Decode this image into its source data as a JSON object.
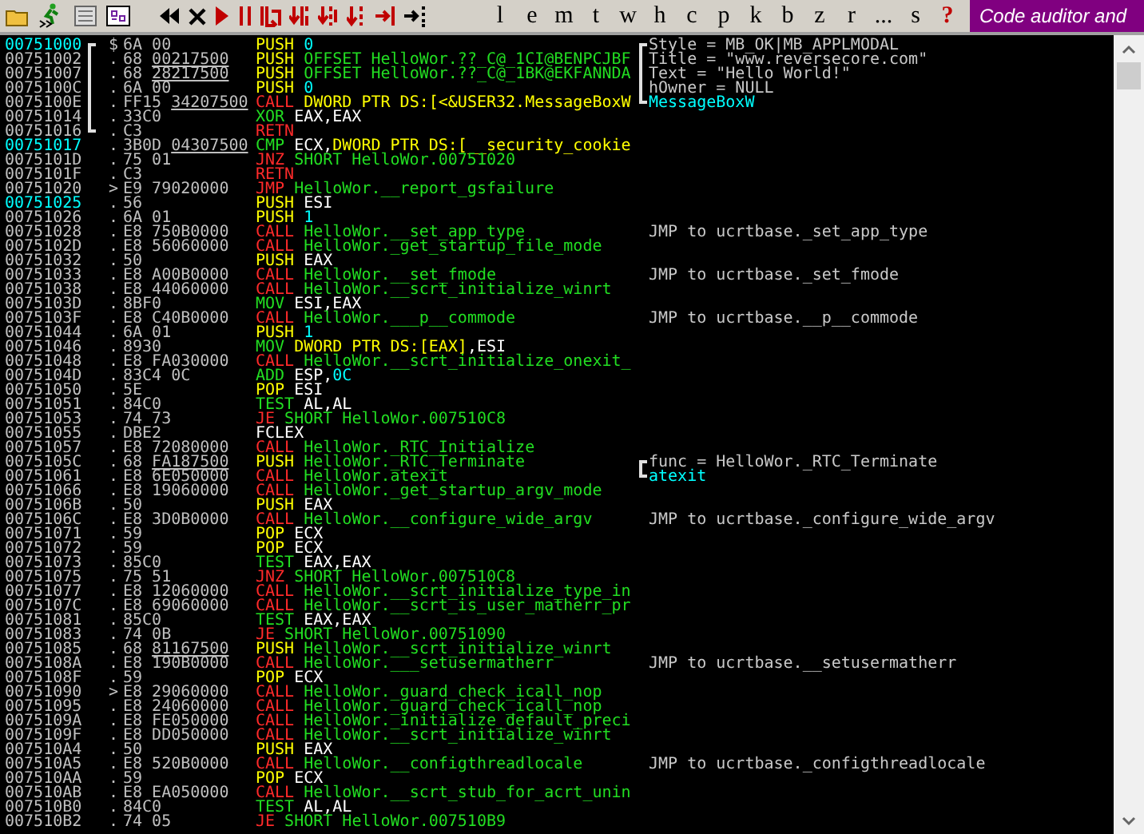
{
  "toolbar": {
    "letters": [
      "l",
      "e",
      "m",
      "t",
      "w",
      "h",
      "c",
      "p",
      "k",
      "b",
      "z",
      "r",
      "...",
      "s"
    ],
    "help": "?",
    "banner": "Code auditor and"
  },
  "rows": [
    {
      "address": "00751000",
      "entry": true,
      "mark": "$",
      "bracket": {
        "kind": "top"
      },
      "hex": "6A 00",
      "mnemonic": "PUSH",
      "kind": "push",
      "operand": [
        {
          "text": "0",
          "kind": "const"
        }
      ],
      "comment": {
        "text": "Style = MB_OK|MB_APPLMODAL",
        "kind": "arg",
        "bracket": {
          "kind": "top"
        }
      }
    },
    {
      "address": "00751002",
      "entry": false,
      "mark": ".",
      "bracket": {
        "kind": "mid"
      },
      "hex": "68",
      "ref": "00217500",
      "mnemonic": "PUSH",
      "kind": "push",
      "operand": [
        {
          "text": "OFFSET HelloWor.??_C@_1CI@BENPCJBF",
          "kind": "label"
        }
      ],
      "comment": {
        "text": "Title = \"www.reversecore.com\"",
        "kind": "arg",
        "bracket": {
          "kind": "mid"
        }
      }
    },
    {
      "address": "00751007",
      "entry": false,
      "mark": ".",
      "bracket": {
        "kind": "mid"
      },
      "hex": "68",
      "ref": "28217500",
      "mnemonic": "PUSH",
      "kind": "push",
      "operand": [
        {
          "text": "OFFSET HelloWor.??_C@_1BK@EKFANNDA",
          "kind": "label"
        }
      ],
      "comment": {
        "text": "Text = \"Hello World!\"",
        "kind": "arg",
        "bracket": {
          "kind": "mid"
        }
      }
    },
    {
      "address": "0075100C",
      "entry": false,
      "mark": ".",
      "bracket": {
        "kind": "mid"
      },
      "hex": "6A 00",
      "mnemonic": "PUSH",
      "kind": "push",
      "operand": [
        {
          "text": "0",
          "kind": "const"
        }
      ],
      "comment": {
        "text": "hOwner = NULL",
        "kind": "arg",
        "bracket": {
          "kind": "mid"
        }
      }
    },
    {
      "address": "0075100E",
      "entry": false,
      "mark": ".",
      "bracket": {
        "kind": "mid"
      },
      "hex": "FF15",
      "ref": "34207500",
      "mnemonic": "CALL",
      "kind": "call",
      "operand": [
        {
          "text": "DWORD PTR DS:[<&USER32.MessageBoxW",
          "kind": "mem"
        }
      ],
      "comment": {
        "text": "MessageBoxW",
        "kind": "api",
        "bracket": {
          "kind": "end"
        }
      }
    },
    {
      "address": "00751014",
      "entry": false,
      "mark": ".",
      "bracket": {
        "kind": "mid"
      },
      "hex": "33C0",
      "mnemonic": "XOR",
      "kind": "alu",
      "operand": [
        {
          "text": "EAX,EAX",
          "kind": "reg"
        }
      ]
    },
    {
      "address": "00751016",
      "entry": false,
      "mark": ".",
      "bracket": {
        "kind": "end"
      },
      "hex": "C3",
      "mnemonic": "RETN",
      "kind": "jump"
    },
    {
      "address": "00751017",
      "entry": true,
      "mark": ".",
      "hex": "3B0D",
      "ref": "04307500",
      "mnemonic": "CMP",
      "kind": "alu",
      "operand": [
        {
          "text": "ECX,",
          "kind": "reg"
        },
        {
          "text": "DWORD PTR DS:[__security_cookie",
          "kind": "mem"
        }
      ]
    },
    {
      "address": "0075101D",
      "entry": false,
      "mark": ".",
      "hex": "75 01",
      "mnemonic": "JNZ",
      "kind": "jump",
      "operand": [
        {
          "text": "SHORT HelloWor.00751020",
          "kind": "label"
        }
      ]
    },
    {
      "address": "0075101F",
      "entry": false,
      "mark": ".",
      "hex": "C3",
      "mnemonic": "RETN",
      "kind": "jump"
    },
    {
      "address": "00751020",
      "entry": false,
      "mark": ">",
      "hex": "E9 79020000",
      "mnemonic": "JMP",
      "kind": "jump",
      "operand": [
        {
          "text": "HelloWor.__report_gsfailure",
          "kind": "label"
        }
      ]
    },
    {
      "address": "00751025",
      "entry": true,
      "mark": ".",
      "hex": "56",
      "mnemonic": "PUSH",
      "kind": "push",
      "operand": [
        {
          "text": "ESI",
          "kind": "reg"
        }
      ]
    },
    {
      "address": "00751026",
      "entry": false,
      "mark": ".",
      "hex": "6A 01",
      "mnemonic": "PUSH",
      "kind": "push",
      "operand": [
        {
          "text": "1",
          "kind": "const"
        }
      ]
    },
    {
      "address": "00751028",
      "entry": false,
      "mark": ".",
      "hex": "E8 750B0000",
      "mnemonic": "CALL",
      "kind": "call",
      "operand": [
        {
          "text": "HelloWor.__set_app_type",
          "kind": "label"
        }
      ],
      "comment": {
        "text": "JMP to ucrtbase._set_app_type",
        "kind": "note"
      }
    },
    {
      "address": "0075102D",
      "entry": false,
      "mark": ".",
      "hex": "E8 56060000",
      "mnemonic": "CALL",
      "kind": "call",
      "operand": [
        {
          "text": "HelloWor._get_startup_file_mode",
          "kind": "label"
        }
      ]
    },
    {
      "address": "00751032",
      "entry": false,
      "mark": ".",
      "hex": "50",
      "mnemonic": "PUSH",
      "kind": "push",
      "operand": [
        {
          "text": "EAX",
          "kind": "reg"
        }
      ]
    },
    {
      "address": "00751033",
      "entry": false,
      "mark": ".",
      "hex": "E8 A00B0000",
      "mnemonic": "CALL",
      "kind": "call",
      "operand": [
        {
          "text": "HelloWor.__set_fmode",
          "kind": "label"
        }
      ],
      "comment": {
        "text": "JMP to ucrtbase._set_fmode",
        "kind": "note"
      }
    },
    {
      "address": "00751038",
      "entry": false,
      "mark": ".",
      "hex": "E8 44060000",
      "mnemonic": "CALL",
      "kind": "call",
      "operand": [
        {
          "text": "HelloWor.__scrt_initialize_winrt",
          "kind": "label"
        }
      ]
    },
    {
      "address": "0075103D",
      "entry": false,
      "mark": ".",
      "hex": "8BF0",
      "mnemonic": "MOV",
      "kind": "alu",
      "operand": [
        {
          "text": "ESI,EAX",
          "kind": "reg"
        }
      ]
    },
    {
      "address": "0075103F",
      "entry": false,
      "mark": ".",
      "hex": "E8 C40B0000",
      "mnemonic": "CALL",
      "kind": "call",
      "operand": [
        {
          "text": "HelloWor.___p__commode",
          "kind": "label"
        }
      ],
      "comment": {
        "text": "JMP to ucrtbase.__p__commode",
        "kind": "note"
      }
    },
    {
      "address": "00751044",
      "entry": false,
      "mark": ".",
      "hex": "6A 01",
      "mnemonic": "PUSH",
      "kind": "push",
      "operand": [
        {
          "text": "1",
          "kind": "const"
        }
      ]
    },
    {
      "address": "00751046",
      "entry": false,
      "mark": ".",
      "hex": "8930",
      "mnemonic": "MOV",
      "kind": "alu",
      "operand": [
        {
          "text": "DWORD PTR DS:[EAX]",
          "kind": "mem"
        },
        {
          "text": ",ESI",
          "kind": "reg"
        }
      ]
    },
    {
      "address": "00751048",
      "entry": false,
      "mark": ".",
      "hex": "E8 FA030000",
      "mnemonic": "CALL",
      "kind": "call",
      "operand": [
        {
          "text": "HelloWor.__scrt_initialize_onexit_",
          "kind": "label"
        }
      ]
    },
    {
      "address": "0075104D",
      "entry": false,
      "mark": ".",
      "hex": "83C4 0C",
      "mnemonic": "ADD",
      "kind": "alu",
      "operand": [
        {
          "text": "ESP,",
          "kind": "reg"
        },
        {
          "text": "0C",
          "kind": "const"
        }
      ]
    },
    {
      "address": "00751050",
      "entry": false,
      "mark": ".",
      "hex": "5E",
      "mnemonic": "POP",
      "kind": "push",
      "operand": [
        {
          "text": "ESI",
          "kind": "reg"
        }
      ]
    },
    {
      "address": "00751051",
      "entry": false,
      "mark": ".",
      "hex": "84C0",
      "mnemonic": "TEST",
      "kind": "alu",
      "operand": [
        {
          "text": "AL,AL",
          "kind": "reg"
        }
      ]
    },
    {
      "address": "00751053",
      "entry": false,
      "mark": ".",
      "hex": "74 73",
      "mnemonic": "JE",
      "kind": "jump",
      "operand": [
        {
          "text": "SHORT HelloWor.007510C8",
          "kind": "label"
        }
      ]
    },
    {
      "address": "00751055",
      "entry": false,
      "mark": ".",
      "hex": "DBE2",
      "mnemonic": "FCLEX",
      "kind": "fpu"
    },
    {
      "address": "00751057",
      "entry": false,
      "mark": ".",
      "hex": "E8 72080000",
      "mnemonic": "CALL",
      "kind": "call",
      "operand": [
        {
          "text": "HelloWor._RTC_Initialize",
          "kind": "label"
        }
      ]
    },
    {
      "address": "0075105C",
      "entry": false,
      "mark": ".",
      "hex": "68",
      "ref": "FA187500",
      "mnemonic": "PUSH",
      "kind": "push",
      "operand": [
        {
          "text": "HelloWor._RTC_Terminate",
          "kind": "label"
        }
      ],
      "comment": {
        "text": "func = HelloWor._RTC_Terminate",
        "kind": "arg",
        "bracket": {
          "kind": "top"
        }
      }
    },
    {
      "address": "00751061",
      "entry": false,
      "mark": ".",
      "hex": "E8 6E050000",
      "mnemonic": "CALL",
      "kind": "call",
      "operand": [
        {
          "text": "HelloWor.atexit",
          "kind": "label"
        }
      ],
      "comment": {
        "text": "atexit",
        "kind": "api",
        "bracket": {
          "kind": "end"
        }
      }
    },
    {
      "address": "00751066",
      "entry": false,
      "mark": ".",
      "hex": "E8 19060000",
      "mnemonic": "CALL",
      "kind": "call",
      "operand": [
        {
          "text": "HelloWor._get_startup_argv_mode",
          "kind": "label"
        }
      ]
    },
    {
      "address": "0075106B",
      "entry": false,
      "mark": ".",
      "hex": "50",
      "mnemonic": "PUSH",
      "kind": "push",
      "operand": [
        {
          "text": "EAX",
          "kind": "reg"
        }
      ]
    },
    {
      "address": "0075106C",
      "entry": false,
      "mark": ".",
      "hex": "E8 3D0B0000",
      "mnemonic": "CALL",
      "kind": "call",
      "operand": [
        {
          "text": "HelloWor.__configure_wide_argv",
          "kind": "label"
        }
      ],
      "comment": {
        "text": "JMP to ucrtbase._configure_wide_argv",
        "kind": "note"
      }
    },
    {
      "address": "00751071",
      "entry": false,
      "mark": ".",
      "hex": "59",
      "mnemonic": "POP",
      "kind": "push",
      "operand": [
        {
          "text": "ECX",
          "kind": "reg"
        }
      ]
    },
    {
      "address": "00751072",
      "entry": false,
      "mark": ".",
      "hex": "59",
      "mnemonic": "POP",
      "kind": "push",
      "operand": [
        {
          "text": "ECX",
          "kind": "reg"
        }
      ]
    },
    {
      "address": "00751073",
      "entry": false,
      "mark": ".",
      "hex": "85C0",
      "mnemonic": "TEST",
      "kind": "alu",
      "operand": [
        {
          "text": "EAX,EAX",
          "kind": "reg"
        }
      ]
    },
    {
      "address": "00751075",
      "entry": false,
      "mark": ".",
      "hex": "75 51",
      "mnemonic": "JNZ",
      "kind": "jump",
      "operand": [
        {
          "text": "SHORT HelloWor.007510C8",
          "kind": "label"
        }
      ]
    },
    {
      "address": "00751077",
      "entry": false,
      "mark": ".",
      "hex": "E8 12060000",
      "mnemonic": "CALL",
      "kind": "call",
      "operand": [
        {
          "text": "HelloWor.__scrt_initialize_type_in",
          "kind": "label"
        }
      ]
    },
    {
      "address": "0075107C",
      "entry": false,
      "mark": ".",
      "hex": "E8 69060000",
      "mnemonic": "CALL",
      "kind": "call",
      "operand": [
        {
          "text": "HelloWor.__scrt_is_user_matherr_pr",
          "kind": "label"
        }
      ]
    },
    {
      "address": "00751081",
      "entry": false,
      "mark": ".",
      "hex": "85C0",
      "mnemonic": "TEST",
      "kind": "alu",
      "operand": [
        {
          "text": "EAX,EAX",
          "kind": "reg"
        }
      ]
    },
    {
      "address": "00751083",
      "entry": false,
      "mark": ".",
      "hex": "74 0B",
      "mnemonic": "JE",
      "kind": "jump",
      "operand": [
        {
          "text": "SHORT HelloWor.00751090",
          "kind": "label"
        }
      ]
    },
    {
      "address": "00751085",
      "entry": false,
      "mark": ".",
      "hex": "68",
      "ref": "81167500",
      "mnemonic": "PUSH",
      "kind": "push",
      "operand": [
        {
          "text": "HelloWor.__scrt_initialize_winrt",
          "kind": "label"
        }
      ]
    },
    {
      "address": "0075108A",
      "entry": false,
      "mark": ".",
      "hex": "E8 190B0000",
      "mnemonic": "CALL",
      "kind": "call",
      "operand": [
        {
          "text": "HelloWor.___setusermatherr",
          "kind": "label"
        }
      ],
      "comment": {
        "text": "JMP to ucrtbase.__setusermatherr",
        "kind": "note"
      }
    },
    {
      "address": "0075108F",
      "entry": false,
      "mark": ".",
      "hex": "59",
      "mnemonic": "POP",
      "kind": "push",
      "operand": [
        {
          "text": "ECX",
          "kind": "reg"
        }
      ]
    },
    {
      "address": "00751090",
      "entry": false,
      "mark": ">",
      "hex": "E8 29060000",
      "mnemonic": "CALL",
      "kind": "call",
      "operand": [
        {
          "text": "HelloWor._guard_check_icall_nop",
          "kind": "label"
        }
      ]
    },
    {
      "address": "00751095",
      "entry": false,
      "mark": ".",
      "hex": "E8 24060000",
      "mnemonic": "CALL",
      "kind": "call",
      "operand": [
        {
          "text": "HelloWor._guard_check_icall_nop",
          "kind": "label"
        }
      ]
    },
    {
      "address": "0075109A",
      "entry": false,
      "mark": ".",
      "hex": "E8 FE050000",
      "mnemonic": "CALL",
      "kind": "call",
      "operand": [
        {
          "text": "HelloWor._initialize_default_preci",
          "kind": "label"
        }
      ]
    },
    {
      "address": "0075109F",
      "entry": false,
      "mark": ".",
      "hex": "E8 DD050000",
      "mnemonic": "CALL",
      "kind": "call",
      "operand": [
        {
          "text": "HelloWor.__scrt_initialize_winrt",
          "kind": "label"
        }
      ]
    },
    {
      "address": "007510A4",
      "entry": false,
      "mark": ".",
      "hex": "50",
      "mnemonic": "PUSH",
      "kind": "push",
      "operand": [
        {
          "text": "EAX",
          "kind": "reg"
        }
      ]
    },
    {
      "address": "007510A5",
      "entry": false,
      "mark": ".",
      "hex": "E8 520B0000",
      "mnemonic": "CALL",
      "kind": "call",
      "operand": [
        {
          "text": "HelloWor.__configthreadlocale",
          "kind": "label"
        }
      ],
      "comment": {
        "text": "JMP to ucrtbase._configthreadlocale",
        "kind": "note"
      }
    },
    {
      "address": "007510AA",
      "entry": false,
      "mark": ".",
      "hex": "59",
      "mnemonic": "POP",
      "kind": "push",
      "operand": [
        {
          "text": "ECX",
          "kind": "reg"
        }
      ]
    },
    {
      "address": "007510AB",
      "entry": false,
      "mark": ".",
      "hex": "E8 EA050000",
      "mnemonic": "CALL",
      "kind": "call",
      "operand": [
        {
          "text": "HelloWor.__scrt_stub_for_acrt_unin",
          "kind": "label"
        }
      ]
    },
    {
      "address": "007510B0",
      "entry": false,
      "mark": ".",
      "hex": "84C0",
      "mnemonic": "TEST",
      "kind": "alu",
      "operand": [
        {
          "text": "AL,AL",
          "kind": "reg"
        }
      ]
    },
    {
      "address": "007510B2",
      "entry": false,
      "mark": ".",
      "hex": "74 05",
      "mnemonic": "JE",
      "kind": "jump",
      "operand": [
        {
          "text": "SHORT HelloWor.007510B9",
          "kind": "label"
        }
      ]
    }
  ]
}
